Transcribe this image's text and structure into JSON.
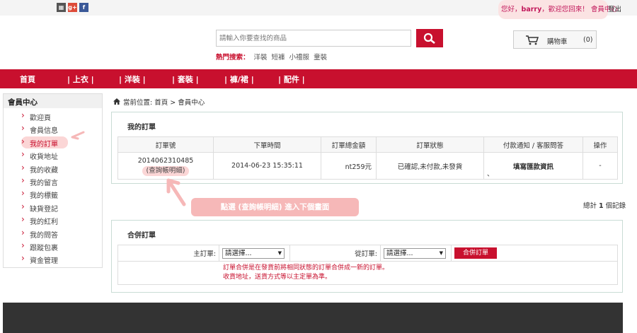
{
  "topbar": {
    "welcome_prefix": "您好，",
    "username": "barry",
    "welcome_suffix": "，歡迎您回來！ 會員中心",
    "logout": "登出"
  },
  "search": {
    "placeholder": "請輸入你要查找的商品"
  },
  "hot": {
    "label": "熱門搜索：",
    "items": [
      "洋裝",
      "短褲",
      "小禮服",
      "童裝"
    ]
  },
  "cart": {
    "label": "購物車",
    "count": "(0)"
  },
  "nav": [
    "首頁",
    "| 上衣 |",
    "| 洋裝 |",
    "| 套裝 |",
    "| 褲/裙 |",
    "| 配件 |"
  ],
  "sidebar": {
    "title": "會員中心",
    "items": [
      "歡迎頁",
      "會員信息",
      "我的訂單",
      "收貨地址",
      "我的收藏",
      "我的留言",
      "我的標籤",
      "缺貨登記",
      "我的紅利",
      "我的問答",
      "跟蹤包裹",
      "資金管理"
    ]
  },
  "breadcrumb": "當前位置: 首頁 > 會員中心",
  "orders": {
    "title": "我的訂單",
    "headers": [
      "訂單號",
      "下單時間",
      "訂單總金額",
      "訂單狀態",
      "付款通知 / 客服問答",
      "操作"
    ],
    "row": {
      "order_no": "2014062310485",
      "detail_link": "(查詢帳明細)",
      "time": "2014-06-23 15:35:11",
      "amount": "nt259元",
      "status": "已確認,未付款,未發貨",
      "payment_notice": "填寫匯款資訊",
      "payment_sep": "、",
      "action": "-"
    }
  },
  "tip": "點選 (查詢帳明細) 進入下個畫面",
  "total": {
    "prefix": "總計 ",
    "count": "1",
    "suffix": " 個記錄"
  },
  "merge": {
    "title": "合併訂單",
    "main_label": "主訂單:",
    "sub_label": "從訂單:",
    "select_placeholder": "請選擇...",
    "button": "合併訂單",
    "note_line1": "訂單合併是在發貨前將相同狀態的訂單合併成一新的訂單。",
    "note_line2": "收貨地址，送貨方式等以主定單為準。"
  },
  "colors": {
    "brand": "#c8102e",
    "highlight": "#fbd6d6"
  }
}
